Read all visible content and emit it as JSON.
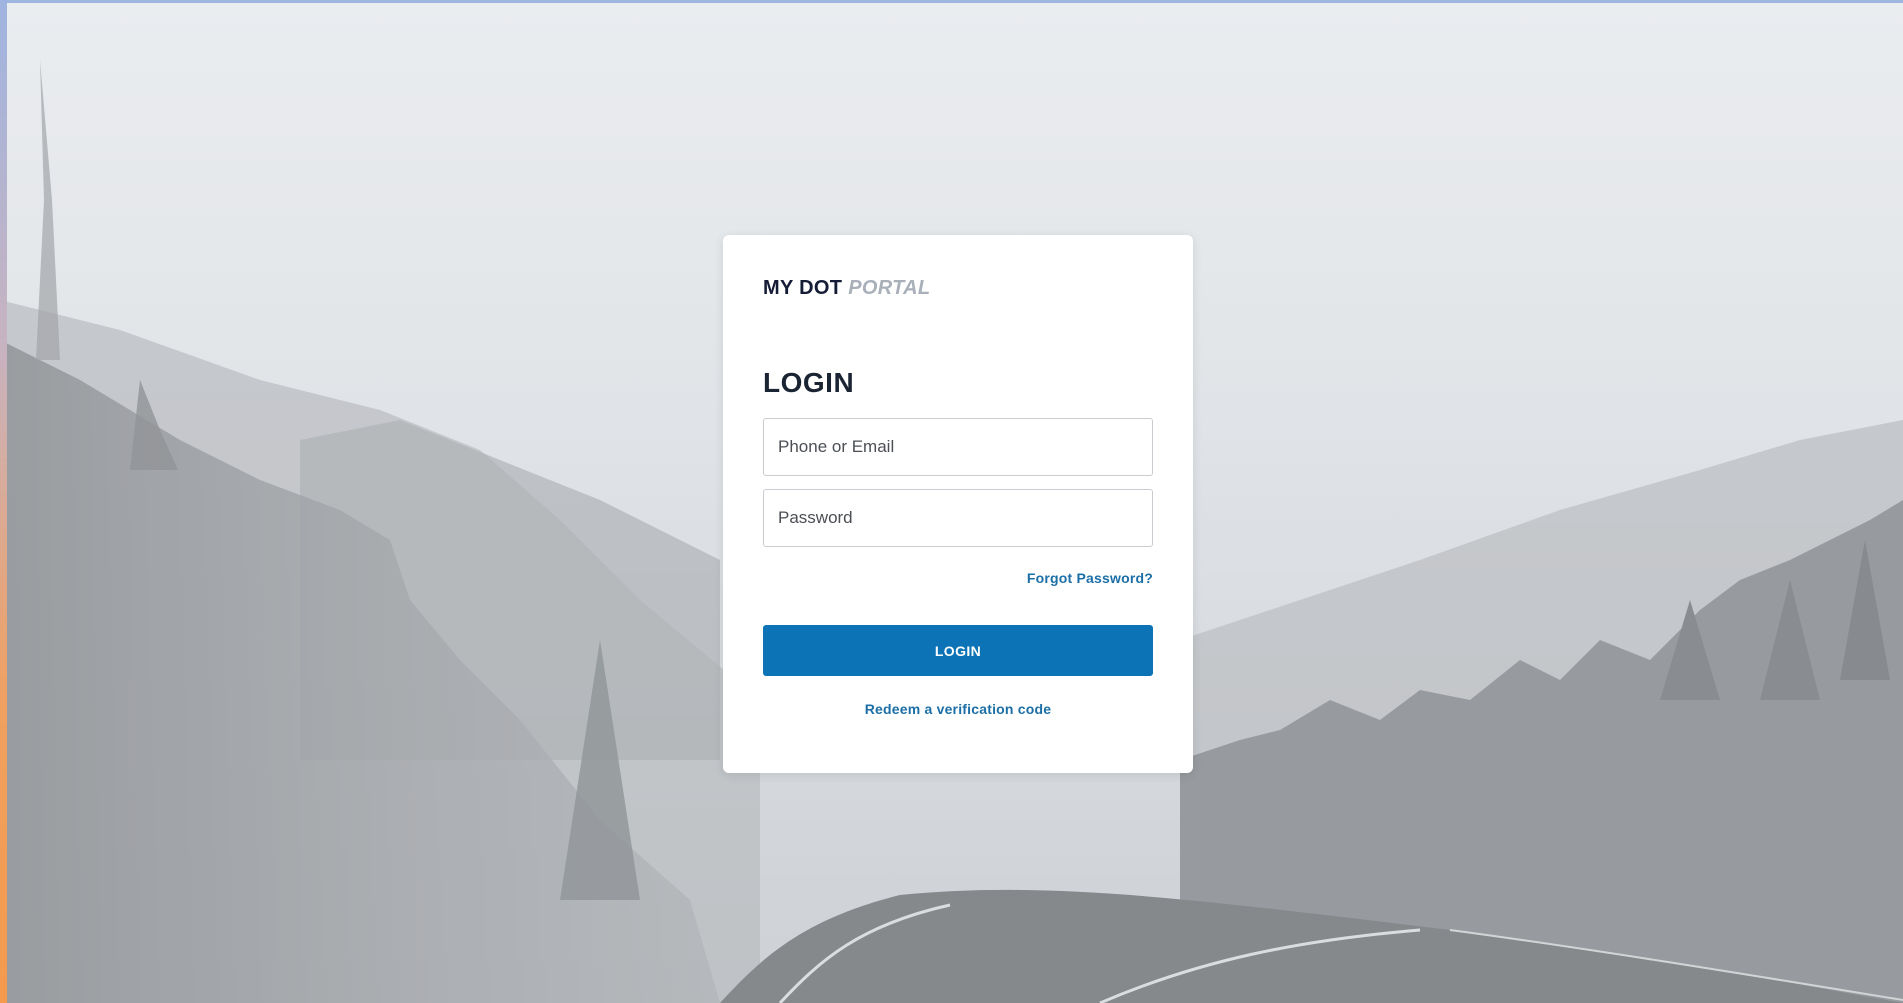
{
  "brand": {
    "name_primary": "MY DOT",
    "name_secondary": "PORTAL"
  },
  "login_form": {
    "heading": "LOGIN",
    "username_placeholder": "Phone or Email",
    "username_value": "",
    "password_placeholder": "Password",
    "password_value": "",
    "forgot_password_label": "Forgot Password?",
    "submit_label": "LOGIN",
    "redeem_code_label": "Redeem a verification code"
  },
  "colors": {
    "primary_button": "#0c74b6",
    "link": "#1c6fa6",
    "heading": "#1a2433",
    "logo_dark": "#151d36",
    "logo_light": "#a9b0ba",
    "card_background": "#ffffff"
  },
  "background": {
    "scene": "foggy-mountain-road-photo"
  }
}
